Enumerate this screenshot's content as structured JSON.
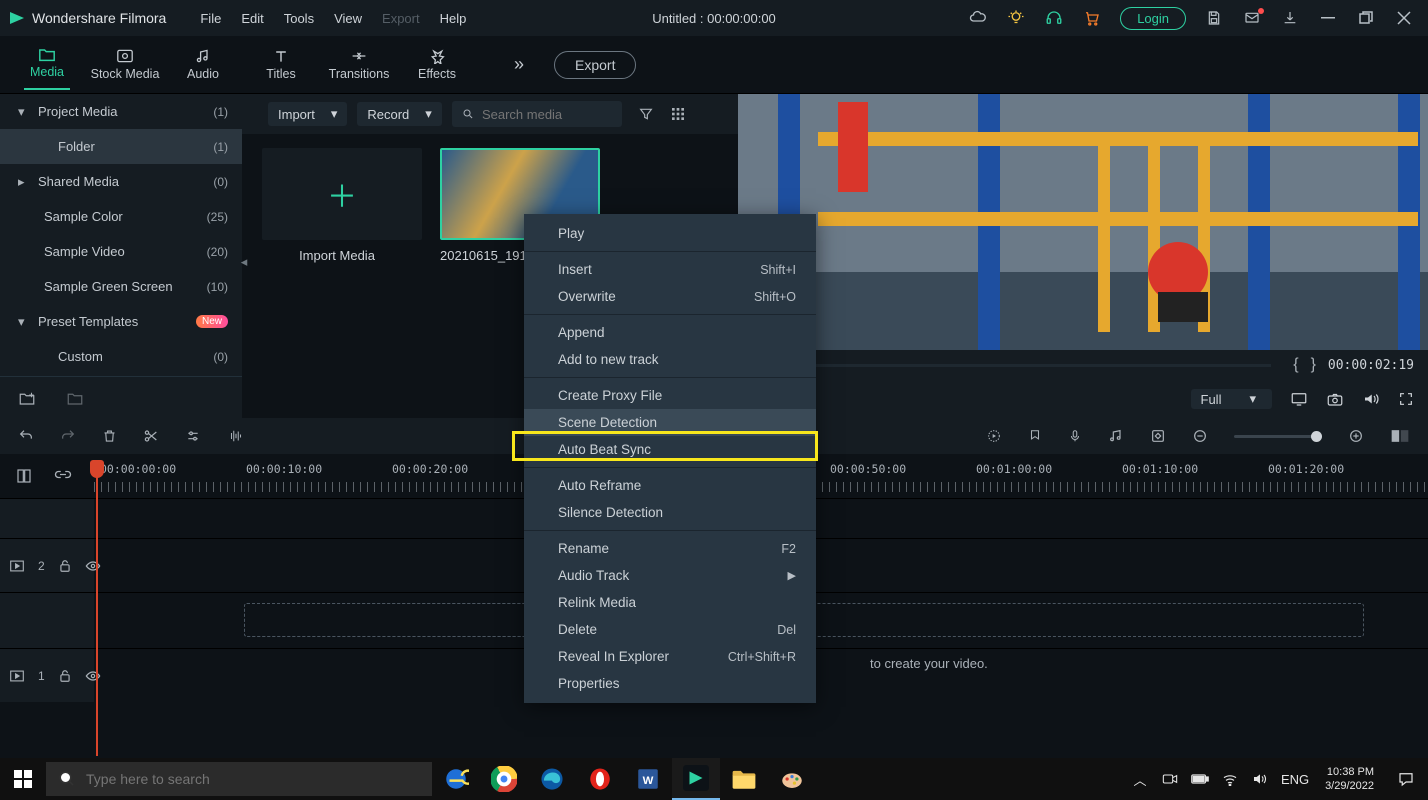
{
  "app": {
    "name": "Wondershare Filmora"
  },
  "menu": {
    "file": "File",
    "edit": "Edit",
    "tools": "Tools",
    "view": "View",
    "export": "Export",
    "help": "Help"
  },
  "title": "Untitled : 00:00:00:00",
  "login": "Login",
  "tabs": {
    "media": "Media",
    "stock": "Stock Media",
    "audio": "Audio",
    "titles": "Titles",
    "transitions": "Transitions",
    "effects": "Effects"
  },
  "export_btn": "Export",
  "sidebar": {
    "items": [
      {
        "label": "Project Media",
        "count": "(1)"
      },
      {
        "label": "Folder",
        "count": "(1)"
      },
      {
        "label": "Shared Media",
        "count": "(0)"
      },
      {
        "label": "Sample Color",
        "count": "(25)"
      },
      {
        "label": "Sample Video",
        "count": "(20)"
      },
      {
        "label": "Sample Green Screen",
        "count": "(10)"
      },
      {
        "label": "Preset Templates",
        "count": ""
      },
      {
        "label": "Custom",
        "count": "(0)"
      }
    ],
    "new_badge": "New"
  },
  "media_toolbar": {
    "import": "Import",
    "record": "Record",
    "search_ph": "Search media"
  },
  "import_tile": "Import Media",
  "clip_name": "20210615_191",
  "preview": {
    "timecode": "00:00:02:19",
    "full": "Full"
  },
  "context": {
    "play": "Play",
    "insert": "Insert",
    "insert_sc": "Shift+I",
    "overwrite": "Overwrite",
    "overwrite_sc": "Shift+O",
    "append": "Append",
    "add_track": "Add to new track",
    "proxy": "Create Proxy File",
    "scene": "Scene Detection",
    "beat": "Auto Beat Sync",
    "reframe": "Auto Reframe",
    "silence": "Silence Detection",
    "rename": "Rename",
    "rename_sc": "F2",
    "audio_track": "Audio Track",
    "relink": "Relink Media",
    "delete": "Delete",
    "delete_sc": "Del",
    "reveal": "Reveal In Explorer",
    "reveal_sc": "Ctrl+Shift+R",
    "properties": "Properties"
  },
  "timeline": {
    "marks": [
      "00:00:00:00",
      "00:00:10:00",
      "00:00:20:00",
      "00:00:50:00",
      "00:01:00:00",
      "00:01:10:00",
      "00:01:20:00"
    ],
    "hint": "to create your video."
  },
  "taskbar": {
    "search_ph": "Type here to search",
    "lang": "ENG",
    "time": "10:38 PM",
    "date": "3/29/2022"
  }
}
